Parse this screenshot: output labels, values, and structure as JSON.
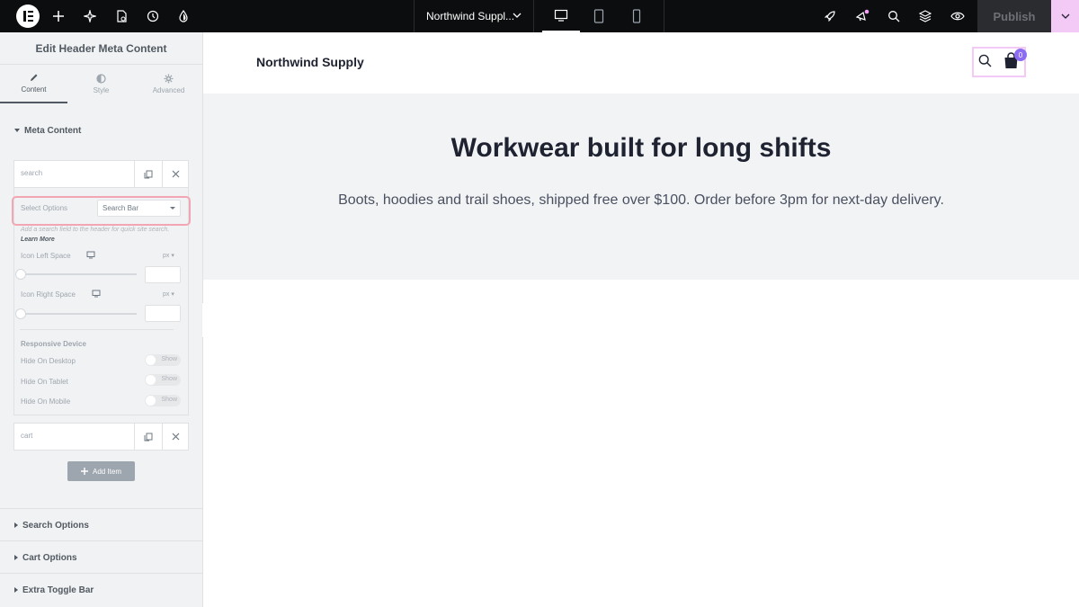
{
  "topbar": {
    "doc_title": "Northwind Suppl...",
    "publish_label": "Publish",
    "icons": [
      "plus-icon",
      "ai-sparkle-icon",
      "page-settings-icon",
      "history-icon",
      "theme-style-icon",
      "rocket-icon",
      "notifications-icon",
      "search-icon",
      "structure-icon",
      "preview-icon"
    ],
    "devices": [
      "desktop",
      "tablet",
      "mobile"
    ],
    "active_device": "desktop"
  },
  "panel": {
    "title": "Edit Header Meta Content",
    "tabs": [
      {
        "label": "Content",
        "icon": "pencil-icon",
        "active": true
      },
      {
        "label": "Style",
        "icon": "contrast-icon",
        "active": false
      },
      {
        "label": "Advanced",
        "icon": "gear-icon",
        "active": false
      }
    ],
    "section_meta": "Meta Content",
    "items": [
      {
        "label": "search"
      },
      {
        "label": "cart"
      }
    ],
    "select_options_label": "Select Options",
    "select_options_value": "Search Bar",
    "help_text": "Add a search field to the header for quick site search.",
    "help_link": "Learn More",
    "icon_left_space_label": "Icon Left Space",
    "icon_right_space_label": "Icon Right Space",
    "unit": "px",
    "responsive_label": "Responsive Device",
    "hide_desktop_label": "Hide On Desktop",
    "hide_tablet_label": "Hide On Tablet",
    "hide_mobile_label": "Hide On Mobile",
    "toggle_text": "Show",
    "add_item_label": "Add Item",
    "sections_collapsed": [
      "Search Options",
      "Cart Options",
      "Extra Toggle Bar"
    ]
  },
  "site": {
    "brand": "Northwind Supply",
    "cart_count": "0",
    "hero_title": "Workwear built for long shifts",
    "hero_text": "Boots, hoodies and trail shoes, shipped free over $100. Order before 3pm for next-day delivery."
  },
  "colors": {
    "topbar_bg": "#0c0d0e",
    "accent_pink": "#f3c9f5",
    "badge_purple": "#8b6cf2",
    "select_highlight": "#f2a6b4"
  }
}
